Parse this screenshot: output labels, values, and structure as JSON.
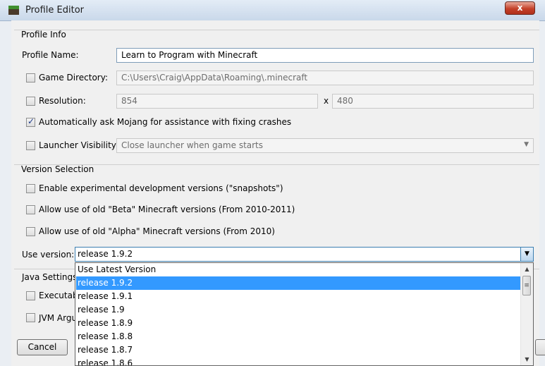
{
  "window": {
    "title": "Profile Editor",
    "close_label": "x"
  },
  "profile_info": {
    "title": "Profile Info",
    "profile_name_label": "Profile Name:",
    "profile_name_value": "Learn to Program with Minecraft",
    "game_directory_label": "Game Directory:",
    "game_directory_value": "C:\\Users\\Craig\\AppData\\Roaming\\.minecraft",
    "resolution_label": "Resolution:",
    "resolution_width": "854",
    "resolution_x": "x",
    "resolution_height": "480",
    "auto_ask_label": "Automatically ask Mojang for assistance with fixing crashes",
    "launcher_visibility_label": "Launcher Visibility:",
    "launcher_visibility_value": "Close launcher when game starts"
  },
  "version_selection": {
    "title": "Version Selection",
    "snapshots_label": "Enable experimental development versions (\"snapshots\")",
    "beta_label": "Allow use of old \"Beta\" Minecraft versions (From 2010-2011)",
    "alpha_label": "Allow use of old \"Alpha\" Minecraft versions (From 2010)",
    "use_version_label": "Use version:",
    "use_version_value": "release 1.9.2",
    "options": [
      "Use Latest Version",
      "release 1.9.2",
      "release 1.9.1",
      "release 1.9",
      "release 1.8.9",
      "release 1.8.8",
      "release 1.8.7",
      "release 1.8.6"
    ],
    "selected_index": 1
  },
  "java_settings": {
    "title": "Java Settings",
    "executable_label": "Executab",
    "jvm_args_label": "JVM Argu"
  },
  "footer": {
    "cancel_label": "Cancel"
  },
  "colors": {
    "selection": "#3399ff",
    "titlebar": "#c9d8ea",
    "close_button": "#c4412a"
  }
}
